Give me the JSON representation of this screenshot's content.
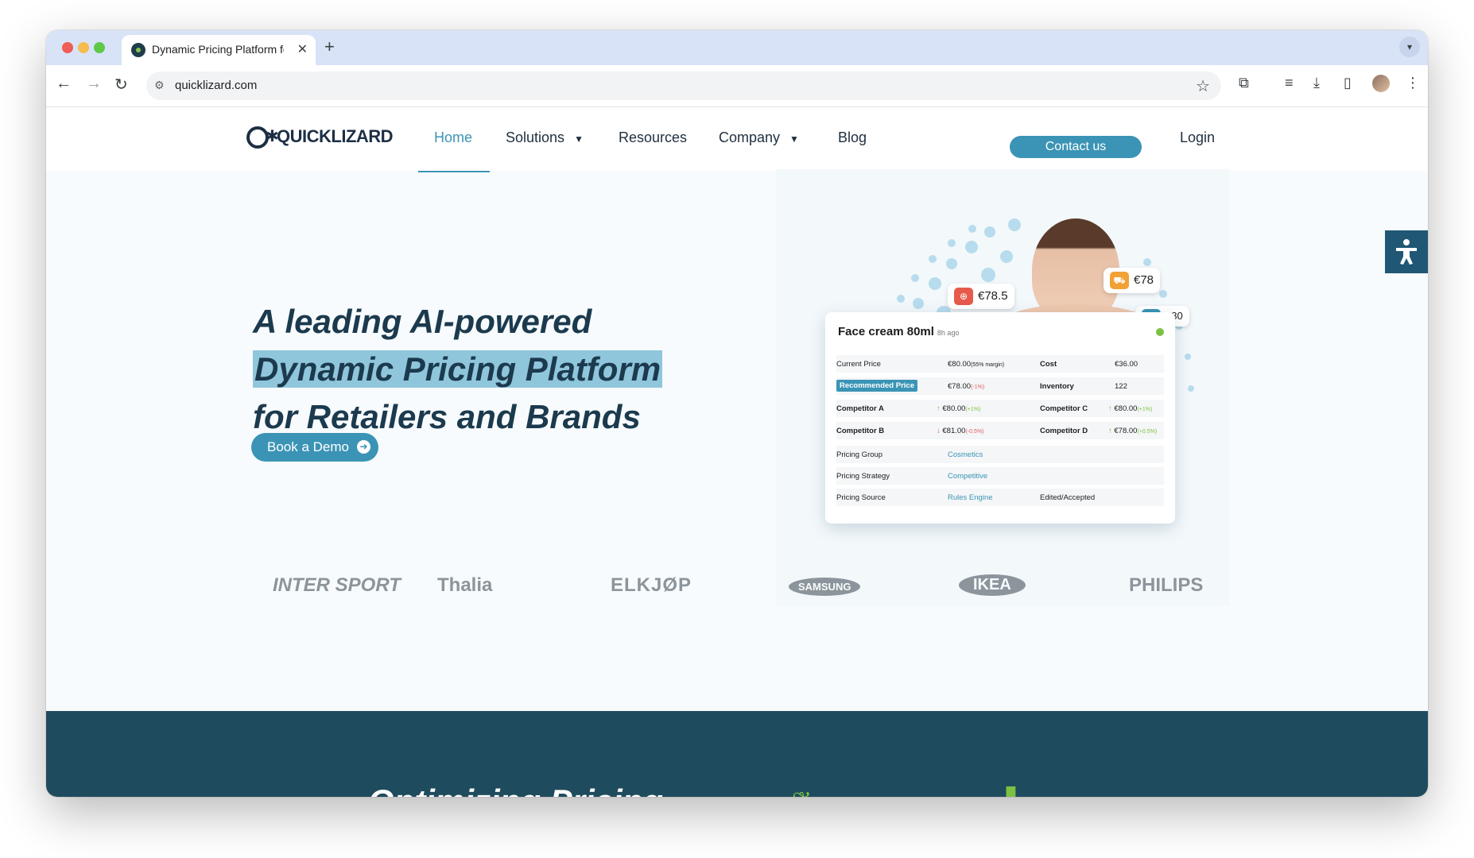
{
  "browser": {
    "tab_title": "Dynamic Pricing Platform for",
    "url": "quicklizard.com",
    "new_tab": "+",
    "tab_close": "✕"
  },
  "site": {
    "logo_text": "QUICKLIZARD",
    "nav": {
      "home": "Home",
      "solutions": "Solutions",
      "resources": "Resources",
      "company": "Company",
      "blog": "Blog",
      "contact": "Contact us",
      "login": "Login"
    }
  },
  "hero": {
    "line1": "A leading AI-powered",
    "line2": "Dynamic Pricing Platform",
    "line3": "for Retailers and Brands",
    "cta": "Book a Demo"
  },
  "illustration": {
    "tags": [
      "€78.5",
      "€78",
      "€80"
    ],
    "card": {
      "title": "Face cream 80ml",
      "age": "8h ago",
      "rows": [
        {
          "l1": "Current Price",
          "v1": "€80.00",
          "n1": "(55% margin)",
          "l2": "Cost",
          "v2": "€36.00"
        },
        {
          "l1": "Recommended Price",
          "v1": "€78.00",
          "n1": "(-1%)",
          "l2": "Inventory",
          "v2": "122"
        },
        {
          "l1": "Competitor A",
          "v1": "€80.00",
          "n1": "(+1%)",
          "l2": "Competitor C",
          "v2": "€80.00",
          "n2": "(+1%)"
        },
        {
          "l1": "Competitor B",
          "v1": "€81.00",
          "n1": "(-0.5%)",
          "l2": "Competitor D",
          "v2": "€78.00",
          "n2": "(+0.5%)"
        },
        {
          "l1": "Pricing Group",
          "v1": "Cosmetics"
        },
        {
          "l1": "Pricing Strategy",
          "v1": "Competitive"
        },
        {
          "l1": "Pricing Source",
          "v1": "Rules Engine",
          "l2": "Edited/Accepted"
        }
      ]
    }
  },
  "brands": [
    "INTER SPORT",
    "Thalia",
    "ELKJØP",
    "SAMSUNG",
    "IKEA",
    "PHILIPS"
  ],
  "section2": {
    "title": "Optimizing Pricing"
  },
  "colors": {
    "brand_blue": "#3b94b5",
    "navy": "#1c3a4e",
    "dark_section": "#1f4b5e",
    "accent_green": "#7cc142"
  }
}
